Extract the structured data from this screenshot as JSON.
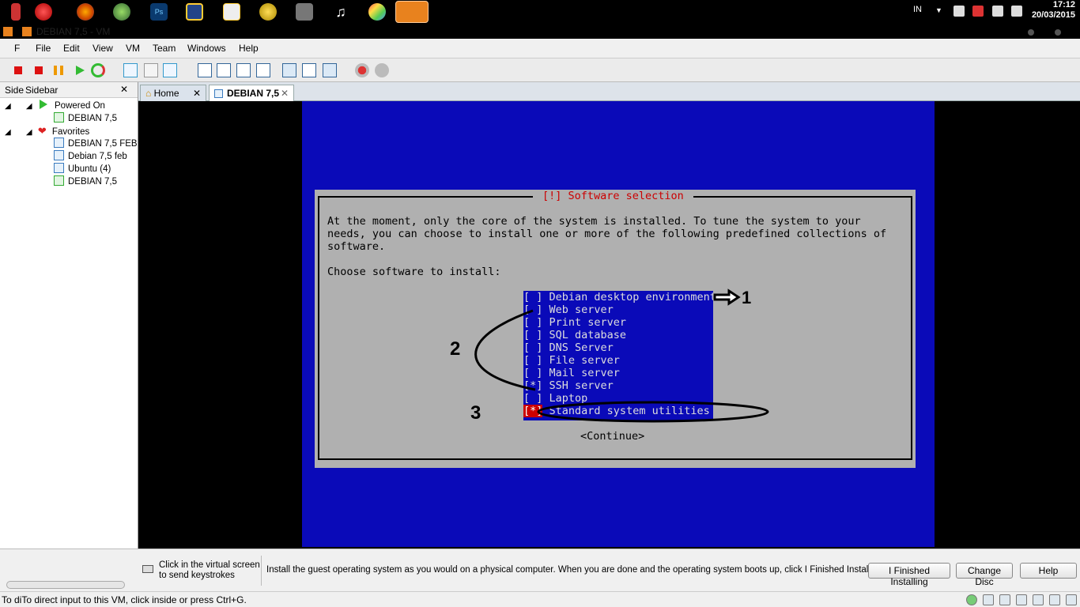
{
  "taskbar": {
    "icons": [
      "fire-icon",
      "apple-icon",
      "firefox-icon",
      "recycle-icon",
      "photoshop-icon",
      "vmware-icon",
      "notepad-icon",
      "atom-icon",
      "bank-icon",
      "music-icon",
      "paint-icon",
      "vmware-active-icon"
    ],
    "ps_label": "Ps",
    "language": "IN",
    "time": "17:12",
    "date": "20/03/2015"
  },
  "window": {
    "title": "DEBIAN 7,5 - VM"
  },
  "menubar": {
    "f_label": "F",
    "items": [
      "File",
      "Edit",
      "View",
      "VM",
      "Team",
      "Windows",
      "Help"
    ]
  },
  "sidebar": {
    "title_short": "Side",
    "title": "Sidebar",
    "close": "✕",
    "groups": [
      {
        "label": "Powered On",
        "items": [
          "DEBIAN 7,5"
        ]
      },
      {
        "label": "Favorites",
        "items": [
          "DEBIAN 7,5 FEB",
          "Debian 7,5 feb",
          "Ubuntu (4)",
          "DEBIAN 7,5"
        ]
      }
    ]
  },
  "tabs": [
    {
      "label": "Home",
      "close": "✕"
    },
    {
      "label": "DEBIAN 7,5",
      "close": "✕"
    }
  ],
  "installer": {
    "dialog_title": "[!] Software selection",
    "intro": "At the moment, only the core of the system is installed. To tune the system to your\nneeds, you can choose to install one or more of the following predefined collections of\nsoftware.",
    "choose": "Choose software to install:",
    "options": [
      {
        "box": "[ ]",
        "label": "Debian desktop environment"
      },
      {
        "box": "[ ]",
        "label": "Web server"
      },
      {
        "box": "[ ]",
        "label": "Print server"
      },
      {
        "box": "[ ]",
        "label": "SQL database"
      },
      {
        "box": "[ ]",
        "label": "DNS Server"
      },
      {
        "box": "[ ]",
        "label": "File server"
      },
      {
        "box": "[ ]",
        "label": "Mail server"
      },
      {
        "box": "[*]",
        "label": "SSH server"
      },
      {
        "box": "[ ]",
        "label": "Laptop"
      },
      {
        "box": "[*]",
        "label": "Standard system utilities"
      }
    ],
    "continue": "<Continue>",
    "annotations": [
      "1",
      "2",
      "3"
    ]
  },
  "hint": {
    "click_text_1": "Click in the virtual screen",
    "click_text_2": "to send keystrokes",
    "message": "Install the guest operating system as you would on a physical computer. When you are done and the operating system boots up, click I Finished Installing.",
    "buttons": [
      "I Finished Installing",
      "Change Disc",
      "Help"
    ]
  },
  "status": {
    "text": "To diTo direct input to this VM, click inside or press Ctrl+G."
  },
  "colors": {
    "installer_blue": "#0a0ab8",
    "dialog_gray": "#b0b0b0",
    "title_red": "#cc0000"
  }
}
